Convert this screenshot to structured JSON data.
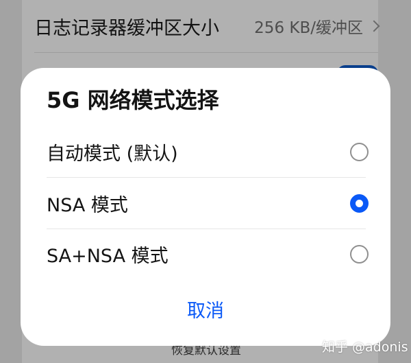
{
  "background": {
    "row": {
      "label": "日志记录器缓冲区大小",
      "value": "256 KB/缓冲区"
    },
    "bottom_text": "恢复默认设置",
    "toggle_color": "#0a3f8c"
  },
  "dialog": {
    "title": "5G 网络模式选择",
    "options": [
      {
        "label": "自动模式 (默认)",
        "selected": false
      },
      {
        "label": "NSA 模式",
        "selected": true
      },
      {
        "label": "SA+NSA 模式",
        "selected": false
      }
    ],
    "cancel_label": "取消",
    "accent_color": "#0a59f7"
  },
  "watermark": "知乎 @adonis"
}
